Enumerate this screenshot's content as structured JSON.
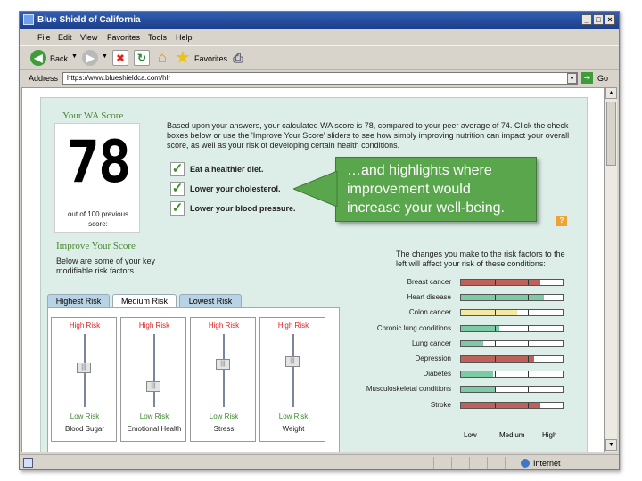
{
  "window": {
    "title": "Blue Shield of California"
  },
  "menu": [
    "File",
    "Edit",
    "View",
    "Favorites",
    "Tools",
    "Help"
  ],
  "toolbar": {
    "back_label": "Back",
    "favorites_label": "Favorites"
  },
  "address": {
    "label": "Address",
    "url": "https://www.blueshieldca.com/hlr",
    "go_label": "Go"
  },
  "status": {
    "zone": "Internet"
  },
  "score": {
    "heading": "Your WA Score",
    "value": "78",
    "previous": "out of 100 previous score:",
    "intro": "Based upon your answers, your calculated WA score is 78, compared to your peer average of 74. Click the check boxes below or use the 'Improve Your Score' sliders to see how simply improving nutrition can impact your overall score, as well as your risk of developing certain health conditions."
  },
  "checkboxes": [
    {
      "label": "Eat a healthier diet.",
      "checked": true
    },
    {
      "label": "Lower your cholesterol.",
      "checked": true
    },
    {
      "label": "Lower your blood pressure.",
      "checked": true
    }
  ],
  "callout": {
    "text": "…and highlights where improvement would increase your well-being."
  },
  "help_icon": "?",
  "improve": {
    "heading": "Improve Your Score",
    "desc": "Below are some of your key modifiable risk factors.",
    "tabs": [
      "Highest Risk",
      "Medium Risk",
      "Lowest Risk"
    ],
    "active_tab": "Medium Risk",
    "high_label": "High Risk",
    "low_label": "Low Risk",
    "sliders": [
      {
        "name": "Blood Sugar",
        "level": 0.55
      },
      {
        "name": "Emotional Health",
        "level": 0.25
      },
      {
        "name": "Stress",
        "level": 0.6
      },
      {
        "name": "Weight",
        "level": 0.65
      }
    ]
  },
  "risk": {
    "intro": "The changes you make to the risk factors to the left will affect your risk of these conditions:",
    "axis": [
      "Low",
      "Medium",
      "High"
    ],
    "colors": {
      "high": "#c0605a",
      "low": "#7ccaa6",
      "medium": "#f3e9a0"
    },
    "conditions": [
      {
        "name": "Breast cancer",
        "level": 0.78,
        "color": "high"
      },
      {
        "name": "Heart disease",
        "level": 0.82,
        "color": "low"
      },
      {
        "name": "Colon cancer",
        "level": 0.55,
        "color": "medium"
      },
      {
        "name": "Chronic lung conditions",
        "level": 0.38,
        "color": "low"
      },
      {
        "name": "Lung cancer",
        "level": 0.22,
        "color": "low"
      },
      {
        "name": "Depression",
        "level": 0.72,
        "color": "high"
      },
      {
        "name": "Diabetes",
        "level": 0.32,
        "color": "low"
      },
      {
        "name": "Musculoskeletal conditions",
        "level": 0.33,
        "color": "low"
      },
      {
        "name": "Stroke",
        "level": 0.78,
        "color": "high"
      }
    ]
  }
}
